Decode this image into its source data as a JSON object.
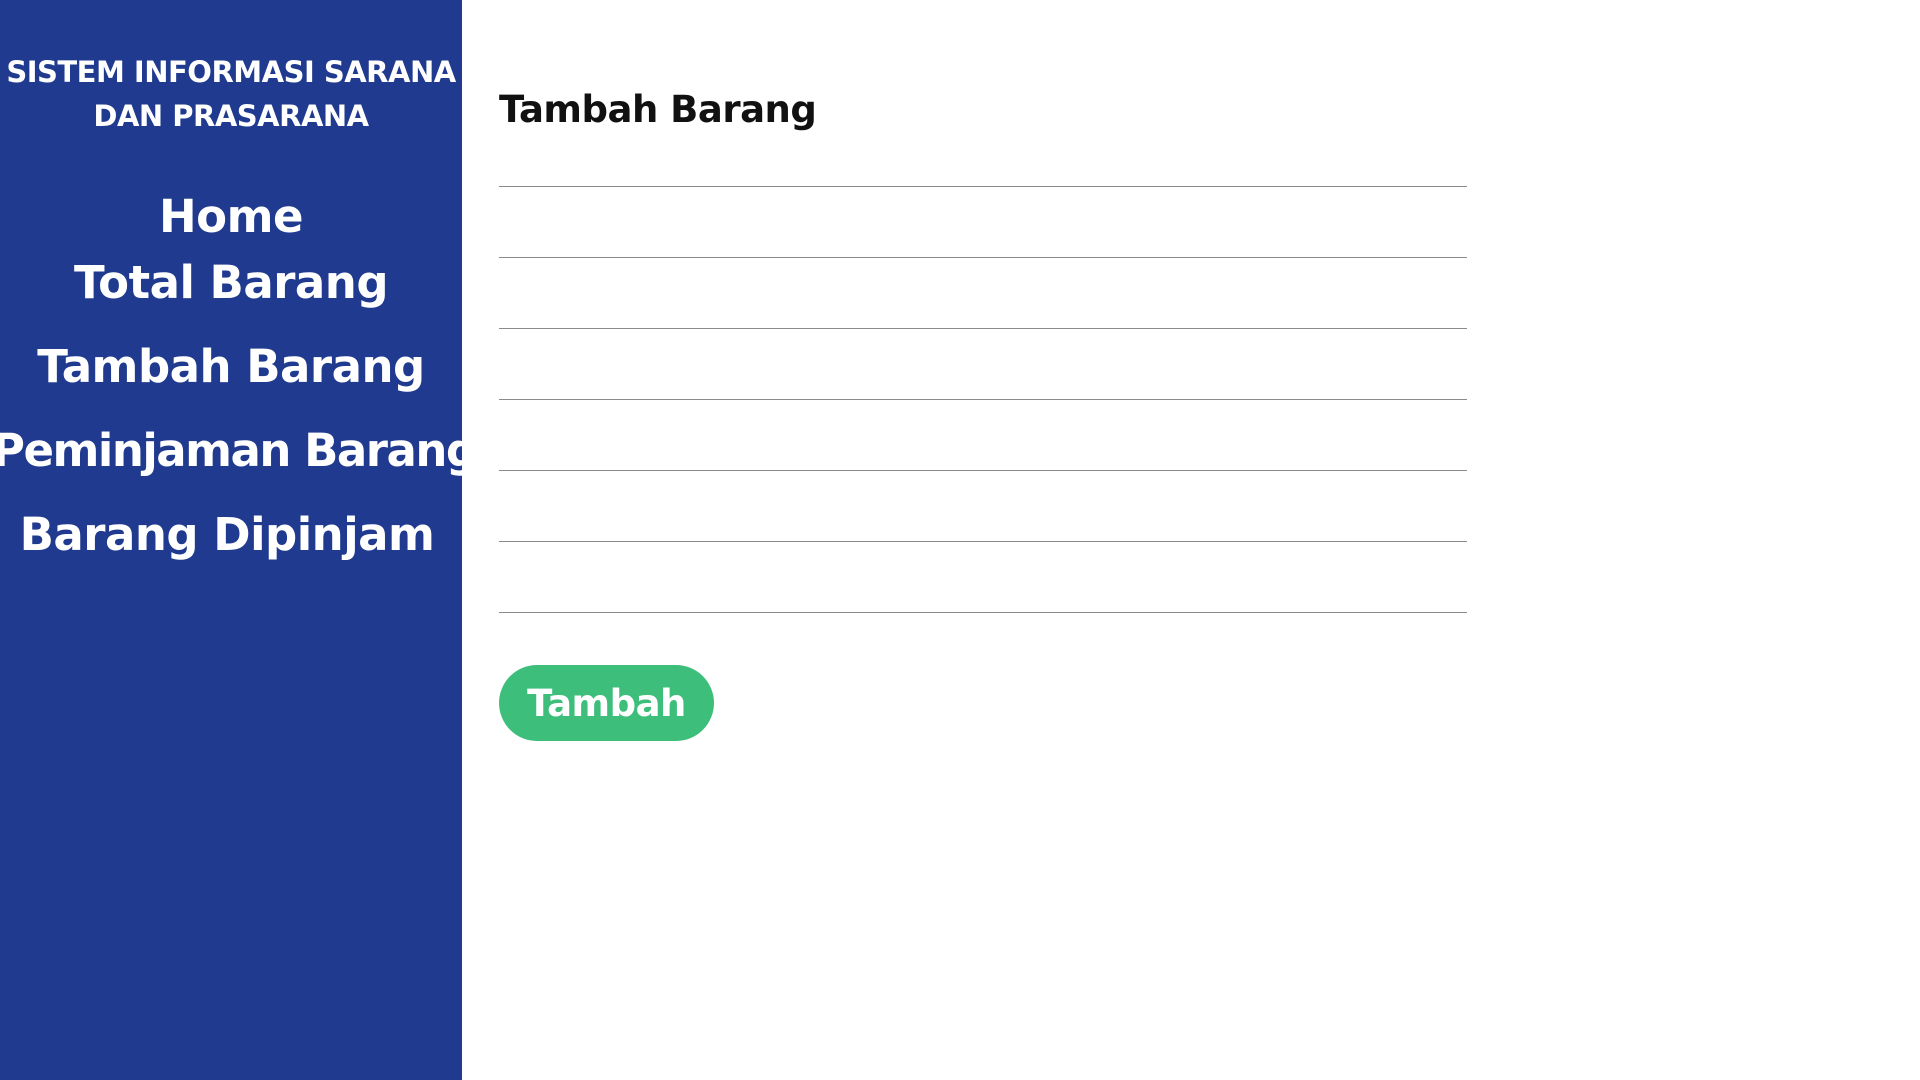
{
  "sidebar": {
    "title_line1": "SISTEM INFORMASI SARANA",
    "title_line2": "DAN PRASARANA",
    "items": [
      {
        "label": "Home"
      },
      {
        "label": "Total Barang"
      },
      {
        "label": "Tambah Barang"
      },
      {
        "label": "Peminjaman Barang"
      },
      {
        "label": "Barang Dipinjam"
      }
    ]
  },
  "main": {
    "title": "Tambah Barang",
    "fields": [
      {
        "value": ""
      },
      {
        "value": ""
      },
      {
        "value": ""
      },
      {
        "value": ""
      },
      {
        "value": ""
      },
      {
        "value": ""
      },
      {
        "value": ""
      }
    ],
    "submit_label": "Tambah"
  },
  "colors": {
    "sidebar_bg": "#1f3a8f",
    "button_bg": "#3dbf7b"
  }
}
